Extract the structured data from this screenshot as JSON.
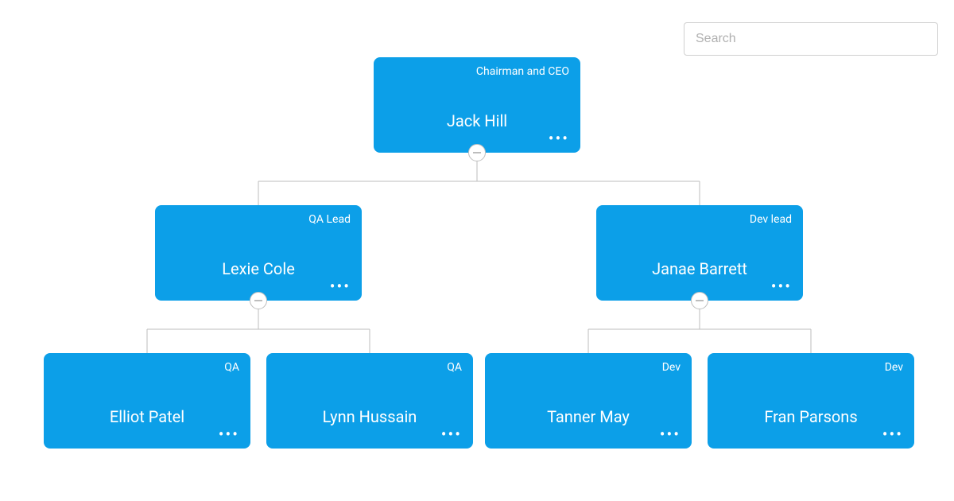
{
  "search": {
    "placeholder": "Search"
  },
  "colors": {
    "node_bg": "#0c9fe8",
    "connector": "#bdbdbd"
  },
  "nodes": {
    "root": {
      "title": "Chairman and CEO",
      "name": "Jack Hill",
      "has_toggle": true
    },
    "qa_lead": {
      "title": "QA Lead",
      "name": "Lexie Cole",
      "has_toggle": true
    },
    "dev_lead": {
      "title": "Dev lead",
      "name": "Janae Barrett",
      "has_toggle": true
    },
    "qa1": {
      "title": "QA",
      "name": "Elliot Patel",
      "has_toggle": false
    },
    "qa2": {
      "title": "QA",
      "name": "Lynn Hussain",
      "has_toggle": false
    },
    "dev1": {
      "title": "Dev",
      "name": "Tanner May",
      "has_toggle": false
    },
    "dev2": {
      "title": "Dev",
      "name": "Fran Parsons",
      "has_toggle": false
    }
  }
}
